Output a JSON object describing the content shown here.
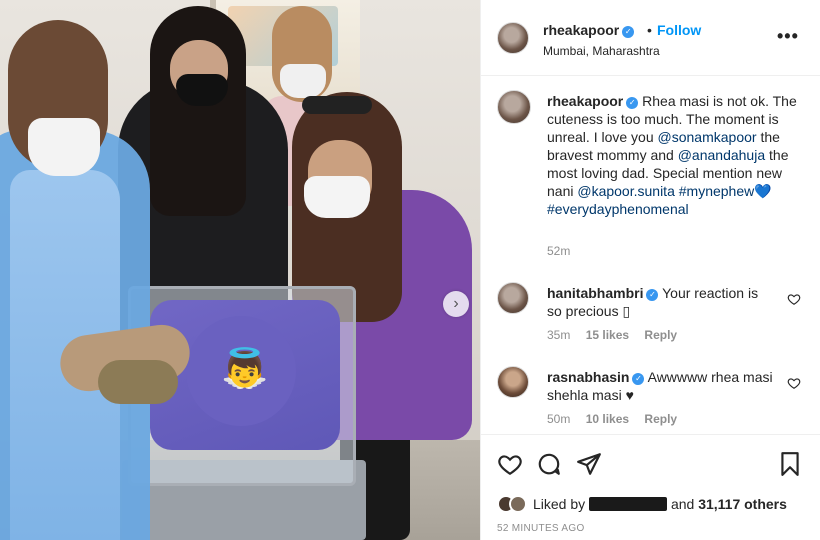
{
  "post": {
    "username": "rheakapoor",
    "follow_label": "Follow",
    "dot": "•",
    "location": "Mumbai, Maharashtra",
    "more_label": "•••",
    "caption": {
      "username": "rheakapoor",
      "text_1": "Rhea masi is not ok. The cuteness is too much. The moment is unreal. I love you ",
      "mention_1": "@sonamkapoor",
      "text_2": " the bravest mommy and ",
      "mention_2": "@anandahuja",
      "text_3": " the most loving dad. Special mention new nani ",
      "mention_3": "@kapoor.sunita",
      "text_4": " ",
      "hashtag_1": "#mynephew",
      "emoji": "💙",
      "hashtag_2": "#everydayphenomenal",
      "time": "52m"
    },
    "baby_emoji": "👼",
    "next_arrow": "›"
  },
  "comments": [
    {
      "username": "hanitabhambri",
      "text": "Your reaction is so precious ",
      "tail": "▯",
      "time": "35m",
      "likes": "15 likes",
      "reply": "Reply"
    },
    {
      "username": "rasnabhasin",
      "text": "Awwwww rhea masi shehla masi ",
      "tail": "♥",
      "time": "50m",
      "likes": "10 likes",
      "reply": "Reply"
    }
  ],
  "footer": {
    "liked_by": "Liked by",
    "and": "and",
    "others": "31,117 others",
    "posted": "52 MINUTES AGO"
  },
  "colors": {
    "accent": "#0095f6",
    "verified": "#3897f0",
    "link": "#00376b",
    "muted": "#8e8e8e"
  }
}
